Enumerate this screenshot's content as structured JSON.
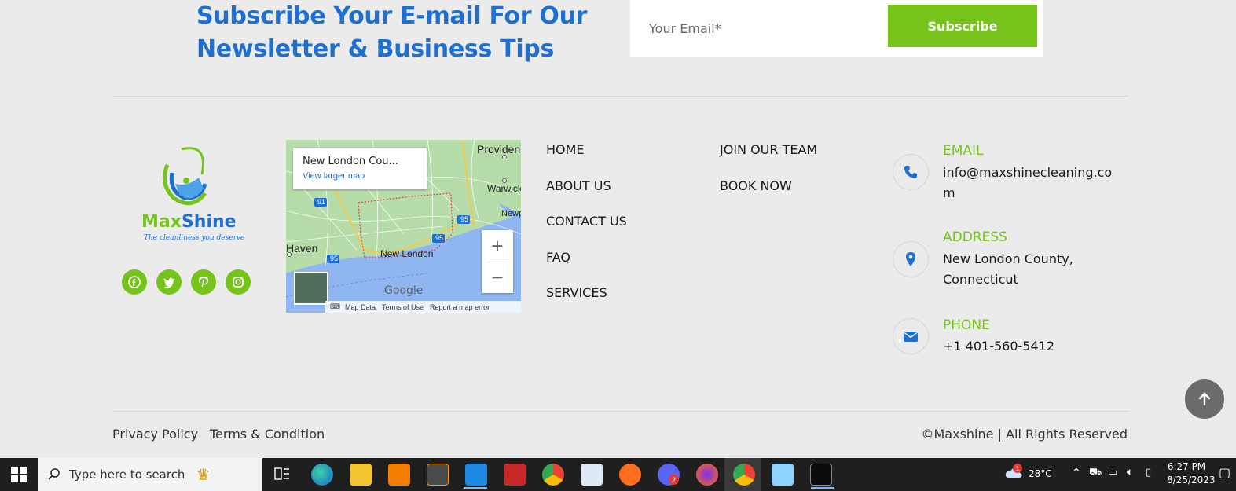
{
  "newsletter": {
    "heading_line1": "Subscribe Your E-mail For Our",
    "heading_line2": "Newsletter & Business Tips",
    "email_placeholder": "Your Email*",
    "subscribe_label": "Subscribe"
  },
  "brand": {
    "name_part1": "Max",
    "name_part2": "Shine",
    "tagline": "The cleanliness you deserve"
  },
  "social": [
    "facebook-icon",
    "twitter-icon",
    "pinterest-icon",
    "instagram-icon"
  ],
  "map": {
    "place": "New London Cou...",
    "view_larger": "View larger map",
    "labels": {
      "providence": "Providen",
      "warwick": "Warwick",
      "newport": "Newp",
      "haven": "Haven",
      "new_london": "New London",
      "google": "Google",
      "i91": "91",
      "i95a": "95",
      "i95b": "95",
      "i95c": "95"
    },
    "zoom_in": "+",
    "zoom_out": "−",
    "footer": [
      "Map Data",
      "Terms of Use",
      "Report a map error"
    ]
  },
  "nav": {
    "col1": [
      "HOME",
      "ABOUT US",
      "CONTACT US",
      "FAQ",
      "SERVICES"
    ],
    "col2": [
      "JOIN OUR TEAM",
      "BOOK NOW"
    ]
  },
  "contact": {
    "email_title": "EMAIL",
    "email_line1": "info@maxshinecleaning.co",
    "email_line2": "m",
    "address_title": "ADDRESS",
    "address_line1": "New London County,",
    "address_line2": "Connecticut",
    "phone_title": "PHONE",
    "phone_value": "+1 401-560-5412"
  },
  "footer": {
    "privacy": "Privacy Policy",
    "terms": "Terms & Condition",
    "copyright": "©Maxshine | All Rights Reserved"
  },
  "taskbar": {
    "search_placeholder": "Type here to search",
    "weather": "28°C",
    "weather_badge": "1",
    "time": "6:27 PM",
    "date": "8/25/2023",
    "app_badge": "2"
  },
  "colors": {
    "accent_green": "#76c31c",
    "heading_blue": "#1e6fcf",
    "background": "#ebebeb"
  }
}
